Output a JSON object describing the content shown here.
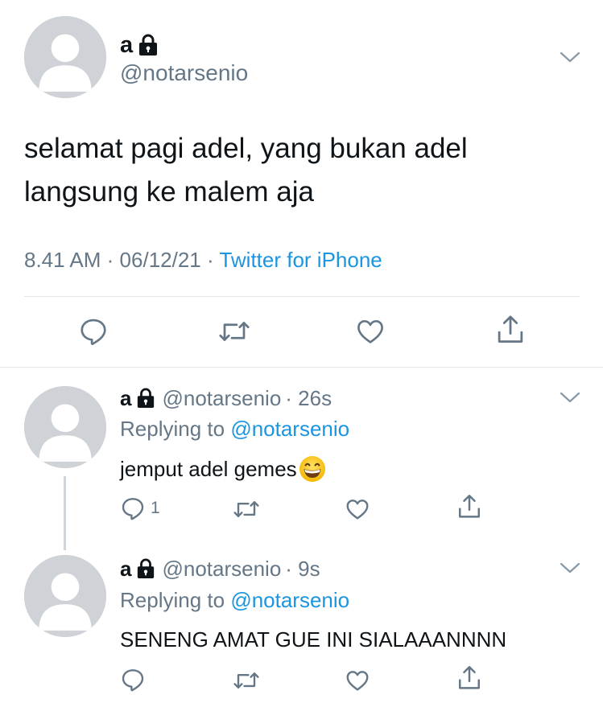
{
  "main_tweet": {
    "author_name": "a",
    "author_handle": "@notarsenio",
    "text_line1": "selamat pagi adel, yang bukan adel",
    "text_line2": "langsung ke malem aja",
    "time": "8.41 AM",
    "date": "06/12/21",
    "source": "Twitter for iPhone",
    "separator": "·"
  },
  "replies": [
    {
      "author_name": "a",
      "author_handle": "@notarsenio",
      "age": "· 26s",
      "replying_prefix": "Replying to ",
      "replying_handle": "@notarsenio",
      "text": "jemput adel gemes",
      "emoji": "grinning-face-with-smiling-eyes",
      "reply_count": "1"
    },
    {
      "author_name": "a",
      "author_handle": "@notarsenio",
      "age": "· 9s",
      "replying_prefix": "Replying to ",
      "replying_handle": "@notarsenio",
      "text": "SENENG AMAT GUE INI SIALAAANNNN",
      "reply_count": ""
    }
  ],
  "colors": {
    "link": "#1b95e0",
    "secondary_text": "#657786",
    "icon": "#657786",
    "divider": "#e1e6ea",
    "avatar": "#cfd2d6"
  },
  "icons": [
    "lock-icon",
    "chevron-down-icon",
    "reply-icon",
    "retweet-icon",
    "like-icon",
    "share-icon"
  ]
}
